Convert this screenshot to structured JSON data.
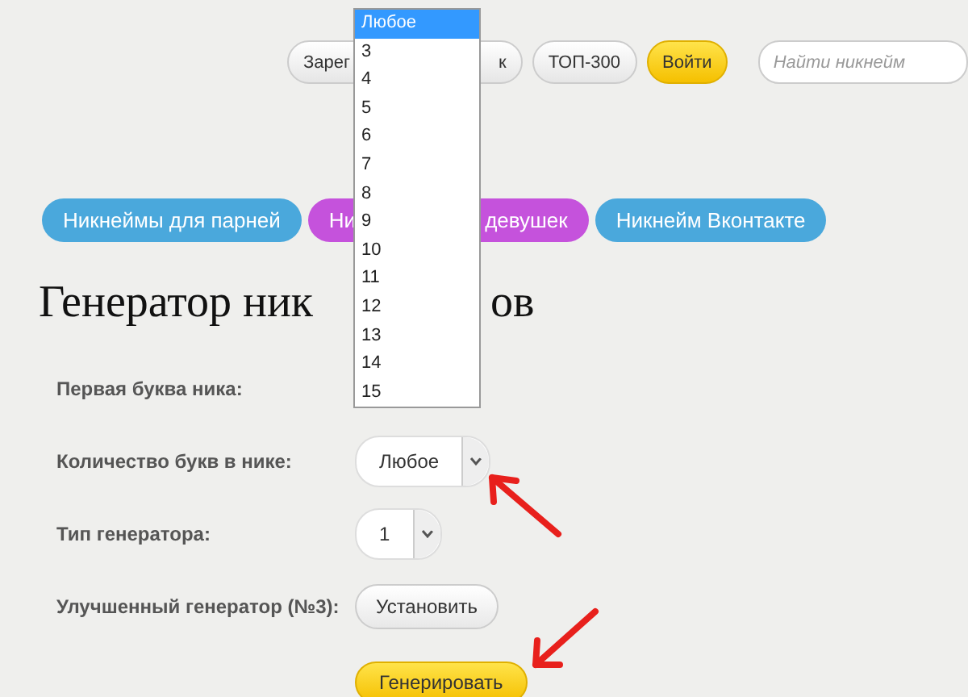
{
  "nav": {
    "buttons": [
      {
        "kind": "plain",
        "parts": [
          "Зарег",
          "к"
        ]
      },
      {
        "kind": "plain",
        "parts": [
          "ТОП-300"
        ]
      },
      {
        "kind": "accent",
        "parts": [
          "Войти"
        ]
      }
    ],
    "search": {
      "placeholder": "Найти никнейм"
    }
  },
  "categories": [
    {
      "color": "#4aa8dc",
      "parts": [
        "Никнеймы для парней"
      ]
    },
    {
      "color": "#c552dc",
      "parts": [
        "Ни",
        "девушек"
      ]
    },
    {
      "color": "#4aa8dc",
      "parts": [
        "Никнейм Вконтакте"
      ]
    }
  ],
  "title": [
    "Генератор ник",
    "ов"
  ],
  "form": [
    {
      "label": "Первая буква ника:"
    },
    {
      "label": "Количество букв в нике:",
      "kind": "select",
      "value": "Любое"
    },
    {
      "label": "Тип генератора:",
      "kind": "select",
      "value": "1"
    },
    {
      "label": "Улучшенный генератор (№3):",
      "kind": "button",
      "value": "Установить"
    }
  ],
  "generate_button": "Генерировать",
  "dropdown": {
    "options": [
      {
        "label": "Любое",
        "selected": true
      },
      {
        "label": "3",
        "selected": false
      },
      {
        "label": "4",
        "selected": false
      },
      {
        "label": "5",
        "selected": false
      },
      {
        "label": "6",
        "selected": false
      },
      {
        "label": "7",
        "selected": false
      },
      {
        "label": "8",
        "selected": false
      },
      {
        "label": "9",
        "selected": false
      },
      {
        "label": "10",
        "selected": false
      },
      {
        "label": "11",
        "selected": false
      },
      {
        "label": "12",
        "selected": false
      },
      {
        "label": "13",
        "selected": false
      },
      {
        "label": "14",
        "selected": false
      },
      {
        "label": "15",
        "selected": false
      }
    ]
  }
}
